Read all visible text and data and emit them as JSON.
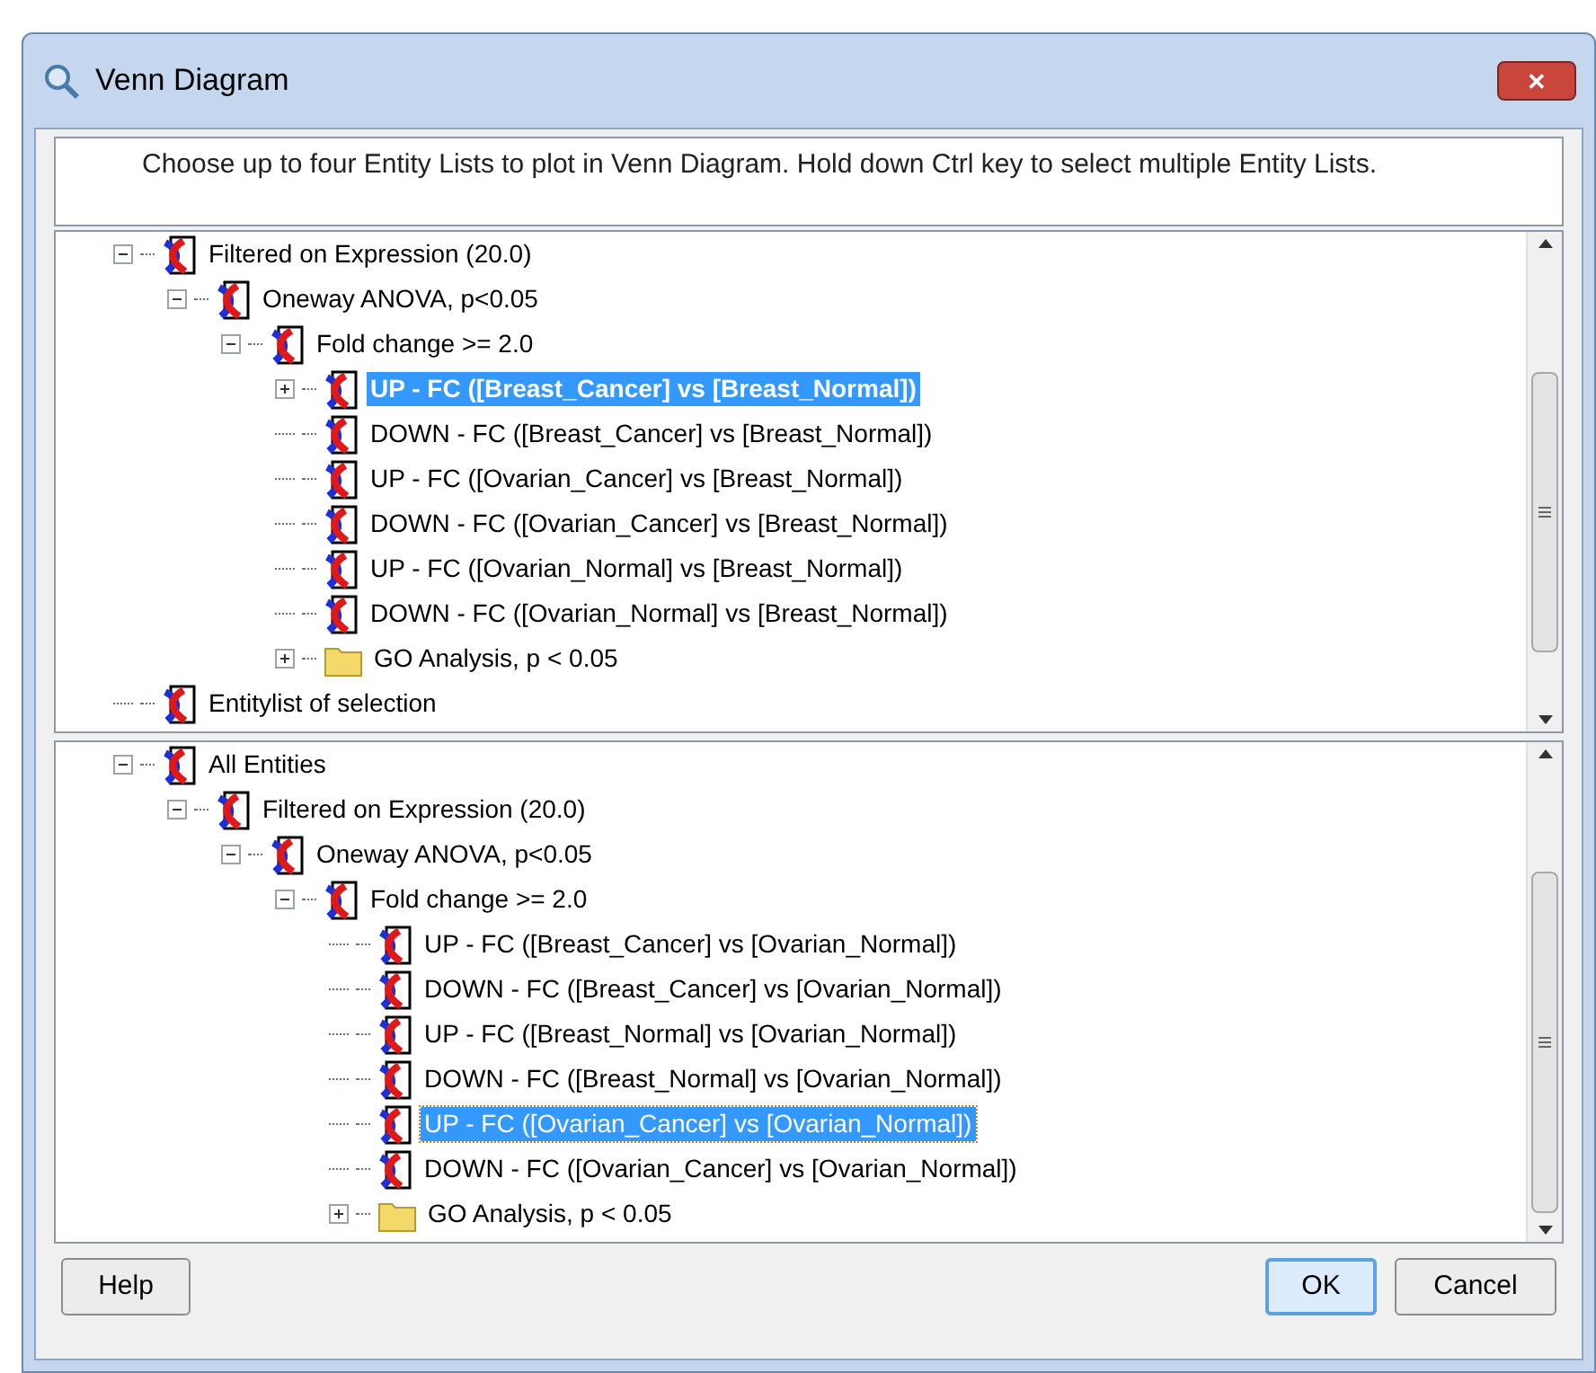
{
  "window": {
    "title": "Venn Diagram",
    "close_label": "✕"
  },
  "instruction": "Choose up to four Entity Lists to plot in Venn Diagram. Hold down Ctrl key to select multiple Entity Lists.",
  "panels": [
    {
      "focused": false,
      "items": [
        {
          "label": "Filtered on Expression (20.0)",
          "kind": "list",
          "expanded": true,
          "selected": false,
          "children": [
            {
              "label": "Oneway ANOVA, p<0.05",
              "kind": "list",
              "expanded": true,
              "selected": false,
              "children": [
                {
                  "label": "Fold change >= 2.0",
                  "kind": "list",
                  "expanded": true,
                  "selected": false,
                  "children": [
                    {
                      "label": "UP - FC ([Breast_Cancer] vs [Breast_Normal])",
                      "kind": "list",
                      "expanded": false,
                      "selected": true
                    },
                    {
                      "label": "DOWN - FC ([Breast_Cancer] vs [Breast_Normal])",
                      "kind": "list",
                      "selected": false
                    },
                    {
                      "label": "UP - FC ([Ovarian_Cancer] vs [Breast_Normal])",
                      "kind": "list",
                      "selected": false
                    },
                    {
                      "label": "DOWN - FC ([Ovarian_Cancer] vs [Breast_Normal])",
                      "kind": "list",
                      "selected": false
                    },
                    {
                      "label": "UP - FC ([Ovarian_Normal] vs [Breast_Normal])",
                      "kind": "list",
                      "selected": false
                    },
                    {
                      "label": "DOWN - FC ([Ovarian_Normal] vs [Breast_Normal])",
                      "kind": "list",
                      "selected": false
                    },
                    {
                      "label": "GO Analysis, p < 0.05",
                      "kind": "folder",
                      "expanded": false,
                      "selected": false
                    }
                  ]
                }
              ]
            }
          ]
        },
        {
          "label": "Entitylist of selection",
          "kind": "list",
          "selected": false
        }
      ]
    },
    {
      "focused": true,
      "items": [
        {
          "label": "All Entities",
          "kind": "list",
          "expanded": true,
          "selected": false,
          "children": [
            {
              "label": "Filtered on Expression (20.0)",
              "kind": "list",
              "expanded": true,
              "selected": false,
              "children": [
                {
                  "label": "Oneway ANOVA, p<0.05",
                  "kind": "list",
                  "expanded": true,
                  "selected": false,
                  "children": [
                    {
                      "label": "Fold change >= 2.0",
                      "kind": "list",
                      "expanded": true,
                      "selected": false,
                      "children": [
                        {
                          "label": "UP - FC ([Breast_Cancer] vs [Ovarian_Normal])",
                          "kind": "list",
                          "selected": false
                        },
                        {
                          "label": "DOWN - FC ([Breast_Cancer] vs [Ovarian_Normal])",
                          "kind": "list",
                          "selected": false
                        },
                        {
                          "label": "UP - FC ([Breast_Normal] vs [Ovarian_Normal])",
                          "kind": "list",
                          "selected": false
                        },
                        {
                          "label": "DOWN - FC ([Breast_Normal] vs [Ovarian_Normal])",
                          "kind": "list",
                          "selected": false
                        },
                        {
                          "label": "UP - FC ([Ovarian_Cancer] vs [Ovarian_Normal])",
                          "kind": "list",
                          "selected": true
                        },
                        {
                          "label": "DOWN - FC ([Ovarian_Cancer] vs [Ovarian_Normal])",
                          "kind": "list",
                          "selected": false
                        },
                        {
                          "label": "GO Analysis, p < 0.05",
                          "kind": "folder",
                          "expanded": false,
                          "selected": false
                        }
                      ]
                    }
                  ]
                }
              ]
            }
          ]
        }
      ]
    }
  ],
  "buttons": [
    {
      "label": "Help",
      "kind": "help",
      "default": false
    },
    {
      "label": "OK",
      "kind": "ok",
      "default": true
    },
    {
      "label": "Cancel",
      "kind": "cancel",
      "default": false
    }
  ]
}
